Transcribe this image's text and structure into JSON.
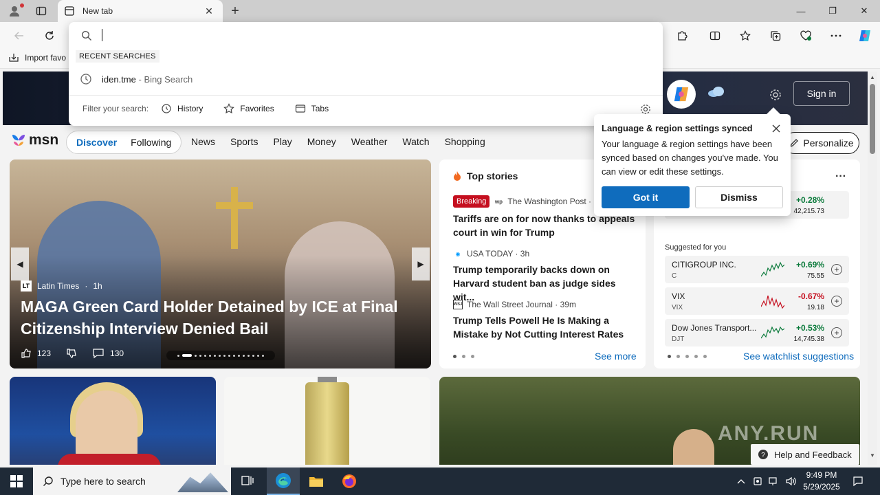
{
  "tab": {
    "title": "New tab",
    "close_glyph": "✕"
  },
  "window": {
    "minimize": "—",
    "maximize": "❐",
    "close": "✕"
  },
  "favorites_bar": {
    "import_label": "Import favo"
  },
  "omnibox": {
    "value": "",
    "recent_label": "RECENT SEARCHES",
    "suggestion": {
      "query": "iden.tme",
      "separator": " - ",
      "engine": "Bing Search"
    },
    "filter_label": "Filter your search:",
    "filters": [
      "History",
      "Favorites",
      "Tabs"
    ]
  },
  "hero": {
    "signin": "Sign in"
  },
  "msn": {
    "logo_text": "msn",
    "pills": [
      "Discover",
      "Following"
    ],
    "nav": [
      "News",
      "Sports",
      "Play",
      "Money",
      "Weather",
      "Watch",
      "Shopping"
    ],
    "personalize": "Personalize"
  },
  "carousel": {
    "source_logo": "LT",
    "source": "Latin Times",
    "age": "1h",
    "headline": "MAGA Green Card Holder Detained by ICE at Final Citizenship Interview Denied Bail",
    "likes": "123",
    "comments": "130"
  },
  "top_stories": {
    "title": "Top stories",
    "items": [
      {
        "badge": "Breaking",
        "logo": "wp",
        "source": "The Washington Post ·",
        "headline": "Tariffs are on for now thanks to appeals court in win for Trump"
      },
      {
        "logo": "◉",
        "source": "USA TODAY · 3h",
        "headline": "Trump temporarily backs down on Harvard student ban as judge sides wit..."
      },
      {
        "logo": "WSJ",
        "source": "The Wall Street Journal · 39m",
        "headline": "Trump Tells Powell He Is Making a Mistake by Not Cutting Interest Rates"
      }
    ],
    "see_more": "See more"
  },
  "watchlist": {
    "more_glyph": "···",
    "top_stock": {
      "change": "+0.28%",
      "value": "42,215.73"
    },
    "suggested_label": "Suggested for you",
    "stocks": [
      {
        "name": "CITIGROUP INC.",
        "symbol": "C",
        "change": "+0.69%",
        "value": "75.55",
        "direction": "up"
      },
      {
        "name": "VIX",
        "symbol": "VIX",
        "change": "-0.67%",
        "value": "19.18",
        "direction": "down"
      },
      {
        "name": "Dow Jones Transport...",
        "symbol": "DJT",
        "change": "+0.53%",
        "value": "14,745.38",
        "direction": "up"
      }
    ],
    "see_suggestions": "See watchlist suggestions"
  },
  "popup": {
    "title": "Language & region settings synced",
    "body": "Your language & region settings have been synced based on changes you've made. You can view or edit these settings.",
    "primary": "Got it",
    "secondary": "Dismiss"
  },
  "help": {
    "label": "Help and Feedback"
  },
  "watermark": "ANY.RUN",
  "taskbar": {
    "search_placeholder": "Type here to search",
    "time": "9:49 PM",
    "date": "5/29/2025"
  },
  "colors": {
    "accent": "#0f6cbd",
    "breaking": "#c50f1f",
    "up": "#0b7a3b",
    "down": "#c50f1f",
    "taskbar": "#1f2a37"
  }
}
